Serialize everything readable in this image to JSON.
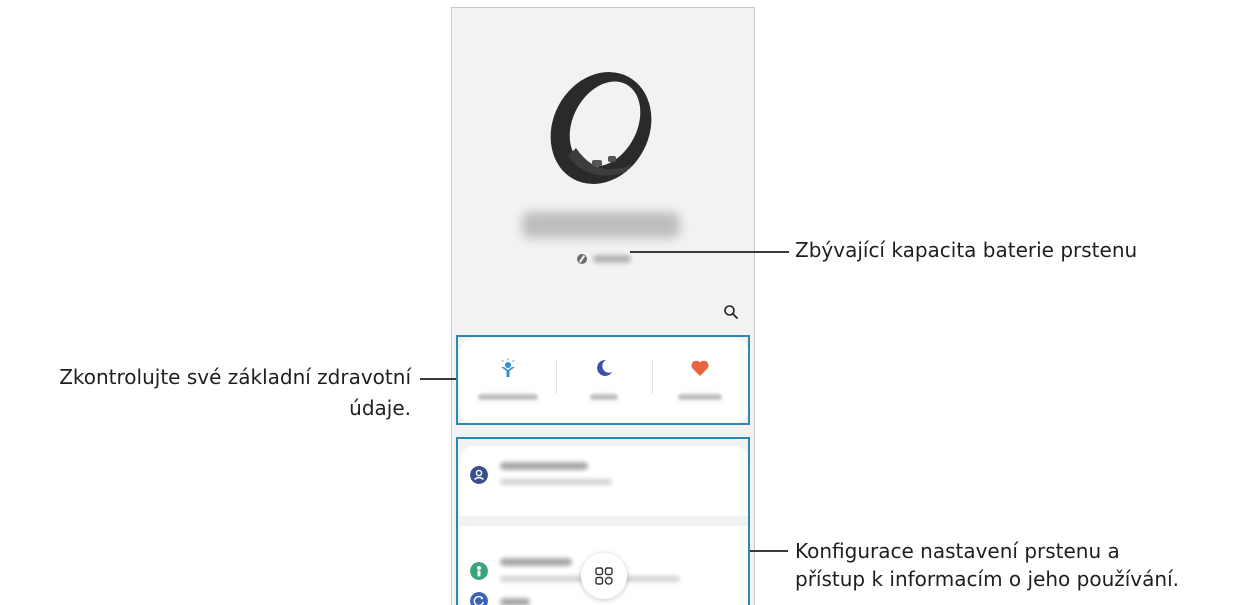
{
  "callouts": {
    "battery": "Zbývající kapacita baterie prstenu",
    "health_line1": "Zkontrolujte své základní zdravotní",
    "health_line2": "údaje.",
    "settings_line1": "Konfigurace nastavení prstenu a",
    "settings_line2": "přístup k informacím o jeho používání."
  },
  "screen": {
    "device_image": "ring-image",
    "battery_icon": "battery-icon",
    "search_icon": "search-icon",
    "health_items": [
      {
        "icon": "energy-score-icon",
        "color": "#2f8fd8"
      },
      {
        "icon": "sleep-moon-icon",
        "color": "#3f4fb0"
      },
      {
        "icon": "heart-icon",
        "color": "#e8643c"
      }
    ],
    "settings_rows": [
      {
        "icon": "account-icon",
        "color": "#3b4f8f"
      },
      {
        "icon": "health-settings-icon",
        "color": "#3aa57a"
      },
      {
        "icon": "reset-icon",
        "color": "#3b63b5"
      }
    ],
    "apps_icon": "apps-grid-icon"
  },
  "colors": {
    "highlight": "#2a87b8",
    "callout_line": "#3a3a3a",
    "screen_background": "#f2f2f2"
  }
}
